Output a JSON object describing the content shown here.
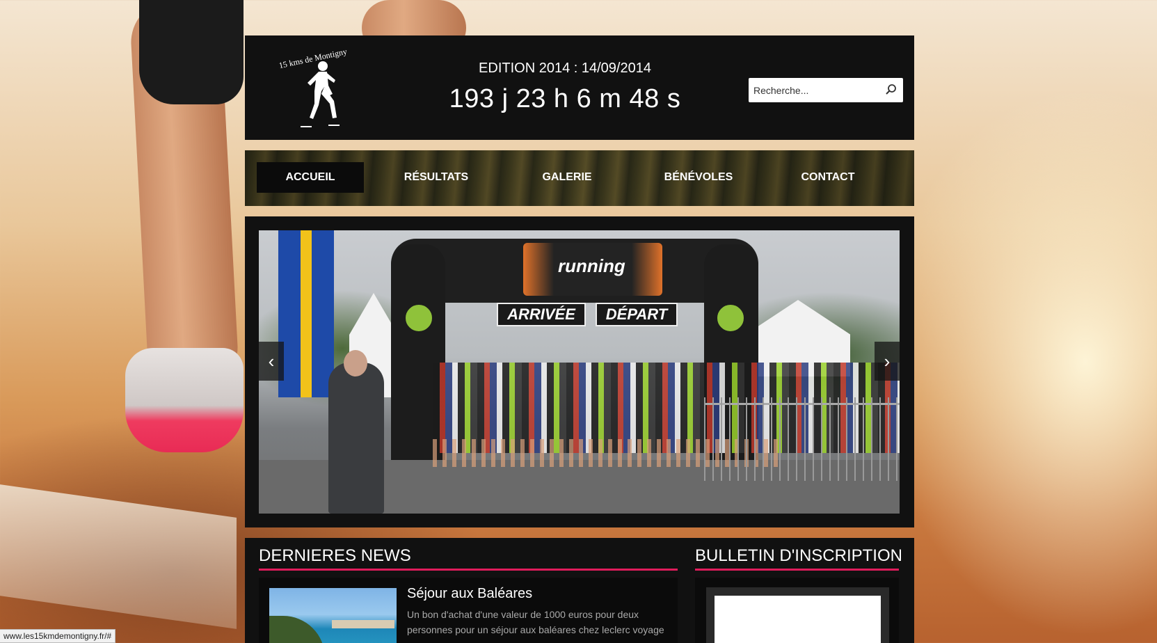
{
  "header": {
    "logo_text": "15 kms de Montigny",
    "edition": "EDITION 2014 : 14/09/2014",
    "countdown": "193 j 23 h 6 m 48 s",
    "search_placeholder": "Recherche..."
  },
  "nav": {
    "items": [
      {
        "label": "ACCUEIL",
        "active": true
      },
      {
        "label": "RÉSULTATS",
        "active": false
      },
      {
        "label": "GALERIE",
        "active": false
      },
      {
        "label": "BÉNÉVOLES",
        "active": false
      },
      {
        "label": "CONTACT",
        "active": false
      }
    ]
  },
  "slider": {
    "banner_left": "ARRIVÉE",
    "banner_right": "DÉPART",
    "arch_brand": "running",
    "prev_label": "‹",
    "next_label": "›"
  },
  "news": {
    "section_title": "DERNIERES NEWS",
    "items": [
      {
        "title": "Séjour aux Baléares",
        "excerpt": "Un bon d'achat d'une valeur de 1000 euros pour deux personnes pour un séjour aux baléares chez leclerc voyage"
      }
    ]
  },
  "bulletin": {
    "section_title": "BULLETIN D'INSCRIPTION"
  },
  "status_bar": {
    "url": "www.les15kmdemontigny.fr/#"
  },
  "colors": {
    "accent": "#e01c5c",
    "panel": "#111111"
  }
}
